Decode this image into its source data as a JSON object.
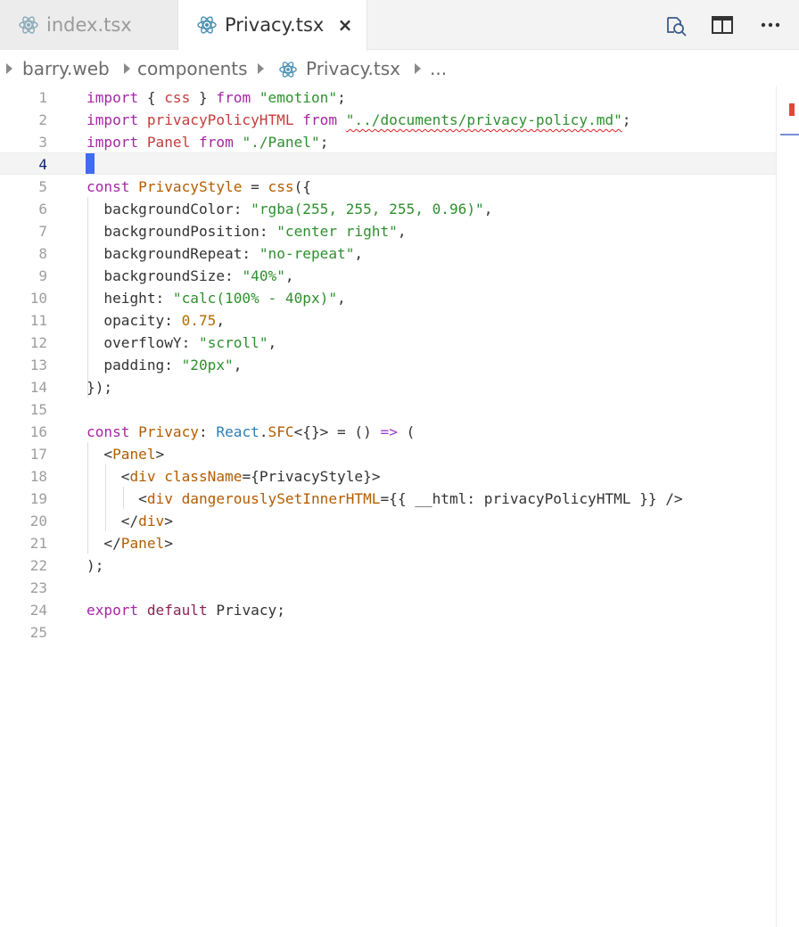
{
  "tabs": [
    {
      "label": "index.tsx",
      "active": false
    },
    {
      "label": "Privacy.tsx",
      "active": true,
      "close_glyph": "×"
    }
  ],
  "toolbar": {
    "icons": [
      "open-changes-icon",
      "split-editor-icon",
      "more-actions-icon"
    ]
  },
  "breadcrumb": {
    "items": [
      "barry.web",
      "components",
      "Privacy.tsx",
      "..."
    ]
  },
  "editor": {
    "language": "typescriptreact",
    "active_line": 4,
    "line_numbers": [
      "1",
      "2",
      "3",
      "4",
      "5",
      "6",
      "7",
      "8",
      "9",
      "10",
      "11",
      "12",
      "13",
      "14",
      "15",
      "16",
      "17",
      "18",
      "19",
      "20",
      "21",
      "22",
      "23",
      "24",
      "25"
    ],
    "lines": [
      [
        [
          "kw",
          "import"
        ],
        [
          "pun",
          " { "
        ],
        [
          "var",
          "css"
        ],
        [
          "pun",
          " } "
        ],
        [
          "kw",
          "from"
        ],
        [
          "pun",
          " "
        ],
        [
          "str",
          "\"emotion\""
        ],
        [
          "pun",
          ";"
        ]
      ],
      [
        [
          "kw",
          "import"
        ],
        [
          "pun",
          " "
        ],
        [
          "var",
          "privacyPolicyHTML"
        ],
        [
          "pun",
          " "
        ],
        [
          "kw",
          "from"
        ],
        [
          "pun",
          " "
        ],
        [
          "str_err",
          "\"../documents/privacy-policy.md\""
        ],
        [
          "pun",
          ";"
        ]
      ],
      [
        [
          "kw",
          "import"
        ],
        [
          "pun",
          " "
        ],
        [
          "var",
          "Panel"
        ],
        [
          "pun",
          " "
        ],
        [
          "kw",
          "from"
        ],
        [
          "pun",
          " "
        ],
        [
          "str",
          "\"./Panel\""
        ],
        [
          "pun",
          ";"
        ]
      ],
      [],
      [
        [
          "kw",
          "const"
        ],
        [
          "pun",
          " "
        ],
        [
          "typ",
          "PrivacyStyle"
        ],
        [
          "pun",
          " = "
        ],
        [
          "typ",
          "css"
        ],
        [
          "pun",
          "({"
        ]
      ],
      [
        [
          "pun",
          "  "
        ],
        [
          "prop",
          "backgroundColor"
        ],
        [
          "pun",
          ": "
        ],
        [
          "str",
          "\"rgba(255, 255, 255, 0.96)\""
        ],
        [
          "pun",
          ","
        ]
      ],
      [
        [
          "pun",
          "  "
        ],
        [
          "prop",
          "backgroundPosition"
        ],
        [
          "pun",
          ": "
        ],
        [
          "str",
          "\"center right\""
        ],
        [
          "pun",
          ","
        ]
      ],
      [
        [
          "pun",
          "  "
        ],
        [
          "prop",
          "backgroundRepeat"
        ],
        [
          "pun",
          ": "
        ],
        [
          "str",
          "\"no-repeat\""
        ],
        [
          "pun",
          ","
        ]
      ],
      [
        [
          "pun",
          "  "
        ],
        [
          "prop",
          "backgroundSize"
        ],
        [
          "pun",
          ": "
        ],
        [
          "str",
          "\"40%\""
        ],
        [
          "pun",
          ","
        ]
      ],
      [
        [
          "pun",
          "  "
        ],
        [
          "prop",
          "height"
        ],
        [
          "pun",
          ": "
        ],
        [
          "str",
          "\"calc(100% - 40px)\""
        ],
        [
          "pun",
          ","
        ]
      ],
      [
        [
          "pun",
          "  "
        ],
        [
          "prop",
          "opacity"
        ],
        [
          "pun",
          ": "
        ],
        [
          "num",
          "0.75"
        ],
        [
          "pun",
          ","
        ]
      ],
      [
        [
          "pun",
          "  "
        ],
        [
          "prop",
          "overflowY"
        ],
        [
          "pun",
          ": "
        ],
        [
          "str",
          "\"scroll\""
        ],
        [
          "pun",
          ","
        ]
      ],
      [
        [
          "pun",
          "  "
        ],
        [
          "prop",
          "padding"
        ],
        [
          "pun",
          ": "
        ],
        [
          "str",
          "\"20px\""
        ],
        [
          "pun",
          ","
        ]
      ],
      [
        [
          "pun",
          "});"
        ]
      ],
      [],
      [
        [
          "kw",
          "const"
        ],
        [
          "pun",
          " "
        ],
        [
          "typ",
          "Privacy"
        ],
        [
          "pun",
          ": "
        ],
        [
          "fn",
          "React"
        ],
        [
          "pun",
          "."
        ],
        [
          "typ",
          "SFC"
        ],
        [
          "pun",
          "<{}> = () "
        ],
        [
          "purple",
          "=>"
        ],
        [
          "pun",
          " ("
        ]
      ],
      [
        [
          "pun",
          "  <"
        ],
        [
          "tag",
          "Panel"
        ],
        [
          "pun",
          ">"
        ]
      ],
      [
        [
          "pun",
          "    <"
        ],
        [
          "tag",
          "div"
        ],
        [
          "pun",
          " "
        ],
        [
          "attr",
          "className"
        ],
        [
          "pun",
          "={"
        ],
        [
          "prop",
          "PrivacyStyle"
        ],
        [
          "pun",
          "}>"
        ]
      ],
      [
        [
          "pun",
          "      <"
        ],
        [
          "tag",
          "div"
        ],
        [
          "pun",
          " "
        ],
        [
          "attr",
          "dangerouslySetInnerHTML"
        ],
        [
          "pun",
          "={{ "
        ],
        [
          "prop",
          "__html"
        ],
        [
          "pun",
          ": "
        ],
        [
          "prop",
          "privacyPolicyHTML"
        ],
        [
          "pun",
          " }} />"
        ]
      ],
      [
        [
          "pun",
          "    </"
        ],
        [
          "tag",
          "div"
        ],
        [
          "pun",
          ">"
        ]
      ],
      [
        [
          "pun",
          "  </"
        ],
        [
          "tag",
          "Panel"
        ],
        [
          "pun",
          ">"
        ]
      ],
      [
        [
          "pun",
          ");"
        ]
      ],
      [],
      [
        [
          "kw",
          "export"
        ],
        [
          "pun",
          " "
        ],
        [
          "kw2",
          "default"
        ],
        [
          "pun",
          " "
        ],
        [
          "prop",
          "Privacy"
        ],
        [
          "pun",
          ";"
        ]
      ],
      []
    ]
  },
  "colors": {
    "accent": "#3f6cf0",
    "error": "#e02020"
  }
}
